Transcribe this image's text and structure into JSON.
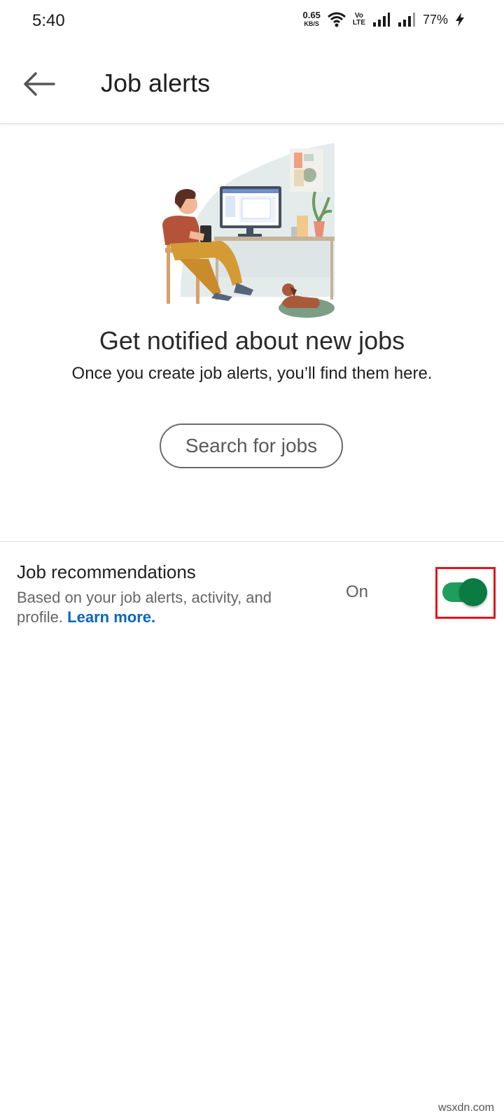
{
  "status_bar": {
    "time": "5:40",
    "speed_value": "0.65",
    "speed_unit": "KB/S",
    "volte_top": "Vo",
    "volte_bottom": "LTE",
    "battery": "77%",
    "icons": [
      "wifi-icon",
      "signal-icon",
      "signal-icon",
      "charging-icon"
    ]
  },
  "header": {
    "back_icon": "arrow-left-icon",
    "title": "Job alerts"
  },
  "empty_state": {
    "illustration": "person-at-desk-illustration",
    "title": "Get notified about new jobs",
    "subtitle": "Once you create job alerts, you’ll find them here.",
    "button_label": "Search for jobs"
  },
  "recommendations": {
    "title": "Job recommendations",
    "description": "Based on your job alerts, activity, and profile.",
    "learn_more": "Learn more.",
    "state_label": "On",
    "enabled": true
  },
  "watermark": "wsxdn.com",
  "colors": {
    "toggle_on": "#1e9e5a",
    "toggle_knob": "#0b7a43",
    "link": "#0a66c2",
    "highlight_frame": "#e0161c"
  }
}
